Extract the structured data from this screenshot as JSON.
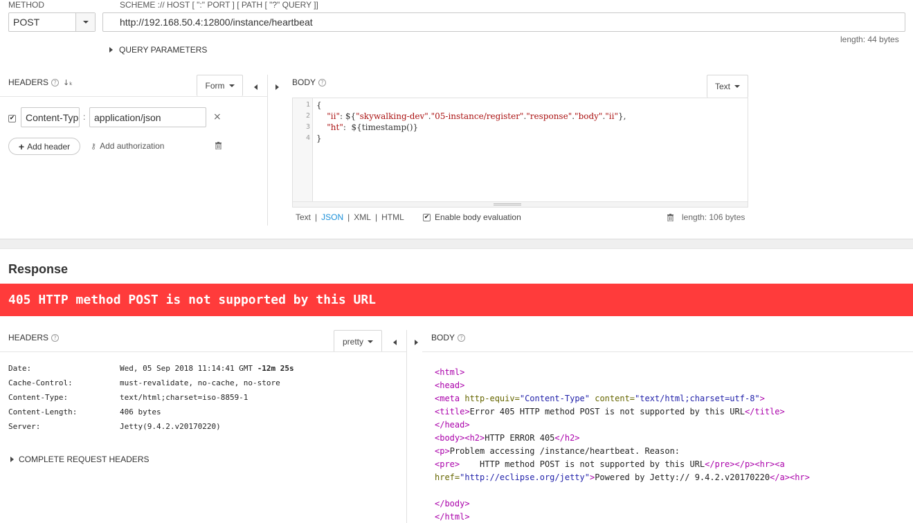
{
  "request": {
    "method_label": "METHOD",
    "method_value": "POST",
    "url_label": "SCHEME :// HOST [ \":\" PORT ] [ PATH [ \"?\" QUERY ]]",
    "url_value": "http://192.168.50.4:12800/instance/heartbeat",
    "url_length": "length: 44 bytes",
    "query_params_label": "QUERY PARAMETERS"
  },
  "headers_panel": {
    "title": "HEADERS",
    "form_button": "Form",
    "header_name": "Content-Type",
    "header_sep": ":",
    "header_value": "application/json",
    "add_header": "Add header",
    "add_authorization": "Add authorization"
  },
  "body_panel": {
    "title": "BODY",
    "type_button": "Text",
    "line_numbers": [
      "1",
      "2",
      "3",
      "4"
    ],
    "lines": {
      "l1": "{",
      "l2_indent": "    ",
      "l2_key": "\"ii\"",
      "l2_colon": ": ${",
      "l2_a1": "\"skywalking-dev\"",
      "l2_c1": ".",
      "l2_a2": "\"05-instance/register\"",
      "l2_c2": ".",
      "l2_a3": "\"response\"",
      "l2_c3": ".",
      "l2_a4": "\"body\"",
      "l2_c4": ".",
      "l2_a5": "\"ii\"",
      "l2_end": "},",
      "l3_indent": "    ",
      "l3_key": "\"ht\"",
      "l3_rest": ":  ${timestamp()}",
      "l4": "}"
    },
    "formats": {
      "text": "Text",
      "sep1": "|",
      "json": "JSON",
      "sep2": "|",
      "xml": "XML",
      "sep3": "|",
      "html": "HTML"
    },
    "enable_eval": "Enable body evaluation",
    "length": "length: 106 bytes"
  },
  "response": {
    "title": "Response",
    "status_banner": "405 HTTP method POST is not supported by this URL",
    "headers_title": "HEADERS",
    "pretty_button": "pretty",
    "body_title": "BODY",
    "headers": [
      {
        "name": "Date:",
        "value": "Wed, 05 Sep 2018 11:14:41 GMT ",
        "extra": "-12m 25s"
      },
      {
        "name": "Cache-Control:",
        "value": "must-revalidate, no-cache, no-store",
        "extra": ""
      },
      {
        "name": "Content-Type:",
        "value": "text/html;charset=iso-8859-1",
        "extra": ""
      },
      {
        "name": "Content-Length:",
        "value": "406 bytes",
        "extra": ""
      },
      {
        "name": "Server:",
        "value": "Jetty(9.4.2.v20170220)",
        "extra": ""
      }
    ],
    "complete_headers": "COMPLETE REQUEST HEADERS",
    "html": {
      "html_open": "<html>",
      "head_open": "<head>",
      "meta_tag": "<meta ",
      "meta_attr1": "http-equiv=",
      "meta_val1": "\"Content-Type\"",
      "meta_attr2": " content=",
      "meta_val2": "\"text/html;charset=utf-8\"",
      "meta_close": ">",
      "title_open": "<title>",
      "title_text": "Error 405 HTTP method POST is not supported by this URL",
      "title_close": "</title>",
      "head_close": "</head>",
      "body_h2_open": "<body><h2>",
      "h2_text": "HTTP ERROR 405",
      "h2_close": "</h2>",
      "p_open": "<p>",
      "p_text": "Problem accessing /instance/heartbeat. Reason:",
      "pre_open": "<pre>",
      "pre_text": "    HTTP method POST is not supported by this URL",
      "pre_close": "</pre></p><hr><a",
      "href_attr": "href=",
      "href_val": "\"http://eclipse.org/jetty\"",
      "a_gt": ">",
      "a_text": "Powered by Jetty:// 9.4.2.v20170220",
      "a_close": "</a><hr>",
      "body_close": "</body>",
      "html_close": "</html>"
    }
  },
  "colors": {
    "banner": "#ff3b3b",
    "link": "#1a8fd8",
    "tag": "#aa00aa",
    "string": "#aa1111"
  }
}
